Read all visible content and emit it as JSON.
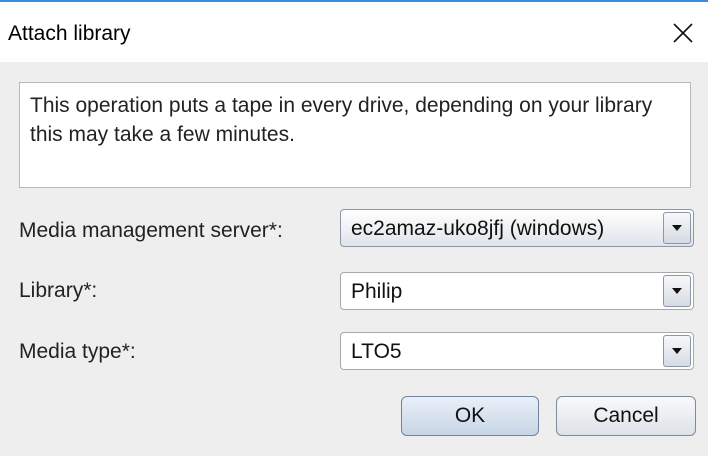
{
  "dialog": {
    "title": "Attach library",
    "message": "This operation puts a tape in every drive, depending on your library this may take a few minutes."
  },
  "form": {
    "server_label": "Media management server*:",
    "server_value": "ec2amaz-uko8jfj (windows)",
    "library_label": "Library*:",
    "library_value": "Philip",
    "media_type_label": "Media type*:",
    "media_type_value": "LTO5"
  },
  "buttons": {
    "ok_label": "OK",
    "cancel_label": "Cancel"
  },
  "icons": {
    "close": "close-icon",
    "dropdown": "chevron-down-icon"
  },
  "colors": {
    "accent_top_border": "#3c8be0",
    "dialog_background": "#eeeeee"
  }
}
